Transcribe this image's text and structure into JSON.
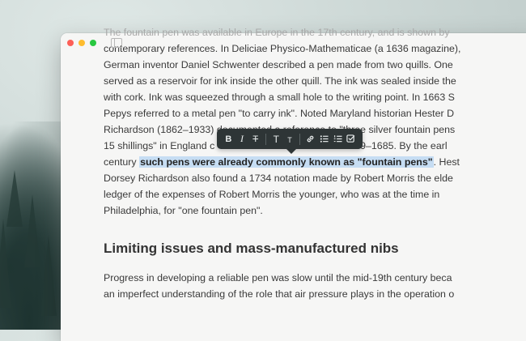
{
  "window": {
    "traffic_lights": [
      "close",
      "minimize",
      "zoom"
    ]
  },
  "document": {
    "lines": [
      "The fountain pen was available in Europe in the 17th century, and is shown by",
      "contemporary references. In Deliciae Physico-Mathematicae (a 1636 magazine),",
      "German inventor Daniel Schwenter described a pen made from two quills. One",
      "served as a reservoir for ink inside the other quill. The ink was sealed inside the",
      "with cork. Ink was squeezed through a small hole to the writing point. In 1663 S",
      "Pepys referred to a metal pen \"to carry ink\". Noted Maryland historian Hester D",
      "Richardson (1862–1933) documented a reference to \"three silver fountain pens",
      "15 shillings\" in England c"
    ],
    "line7_tail": "649–1685. By the earl",
    "line8_prefix": "century ",
    "highlighted": "such pens were already commonly known as \"fountain pens\"",
    "line8_suffix": ". Hest",
    "lines_after": [
      "Dorsey Richardson also found a 1734 notation made by Robert Morris the elde",
      "ledger of the expenses of Robert Morris the younger, who was at the time in",
      "Philadelphia, for \"one fountain pen\"."
    ],
    "heading": "Limiting issues and mass-manufactured nibs",
    "para2_lines": [
      "Progress in developing a reliable pen was slow until the mid-19th century beca",
      "an imperfect understanding of the role that air pressure plays in the operation o"
    ]
  },
  "toolbar": {
    "bold": "B",
    "italic": "I",
    "strike": "T",
    "heading1": "T",
    "heading2": "T",
    "icons": [
      "bold-icon",
      "italic-icon",
      "strikethrough-icon",
      "heading1-icon",
      "heading2-icon",
      "link-icon",
      "bullet-list-icon",
      "numbered-list-icon",
      "checklist-icon"
    ]
  },
  "colors": {
    "highlight": "#c6ddf3",
    "toolbar_bg": "#2e3536",
    "text": "#3a3a3a"
  }
}
